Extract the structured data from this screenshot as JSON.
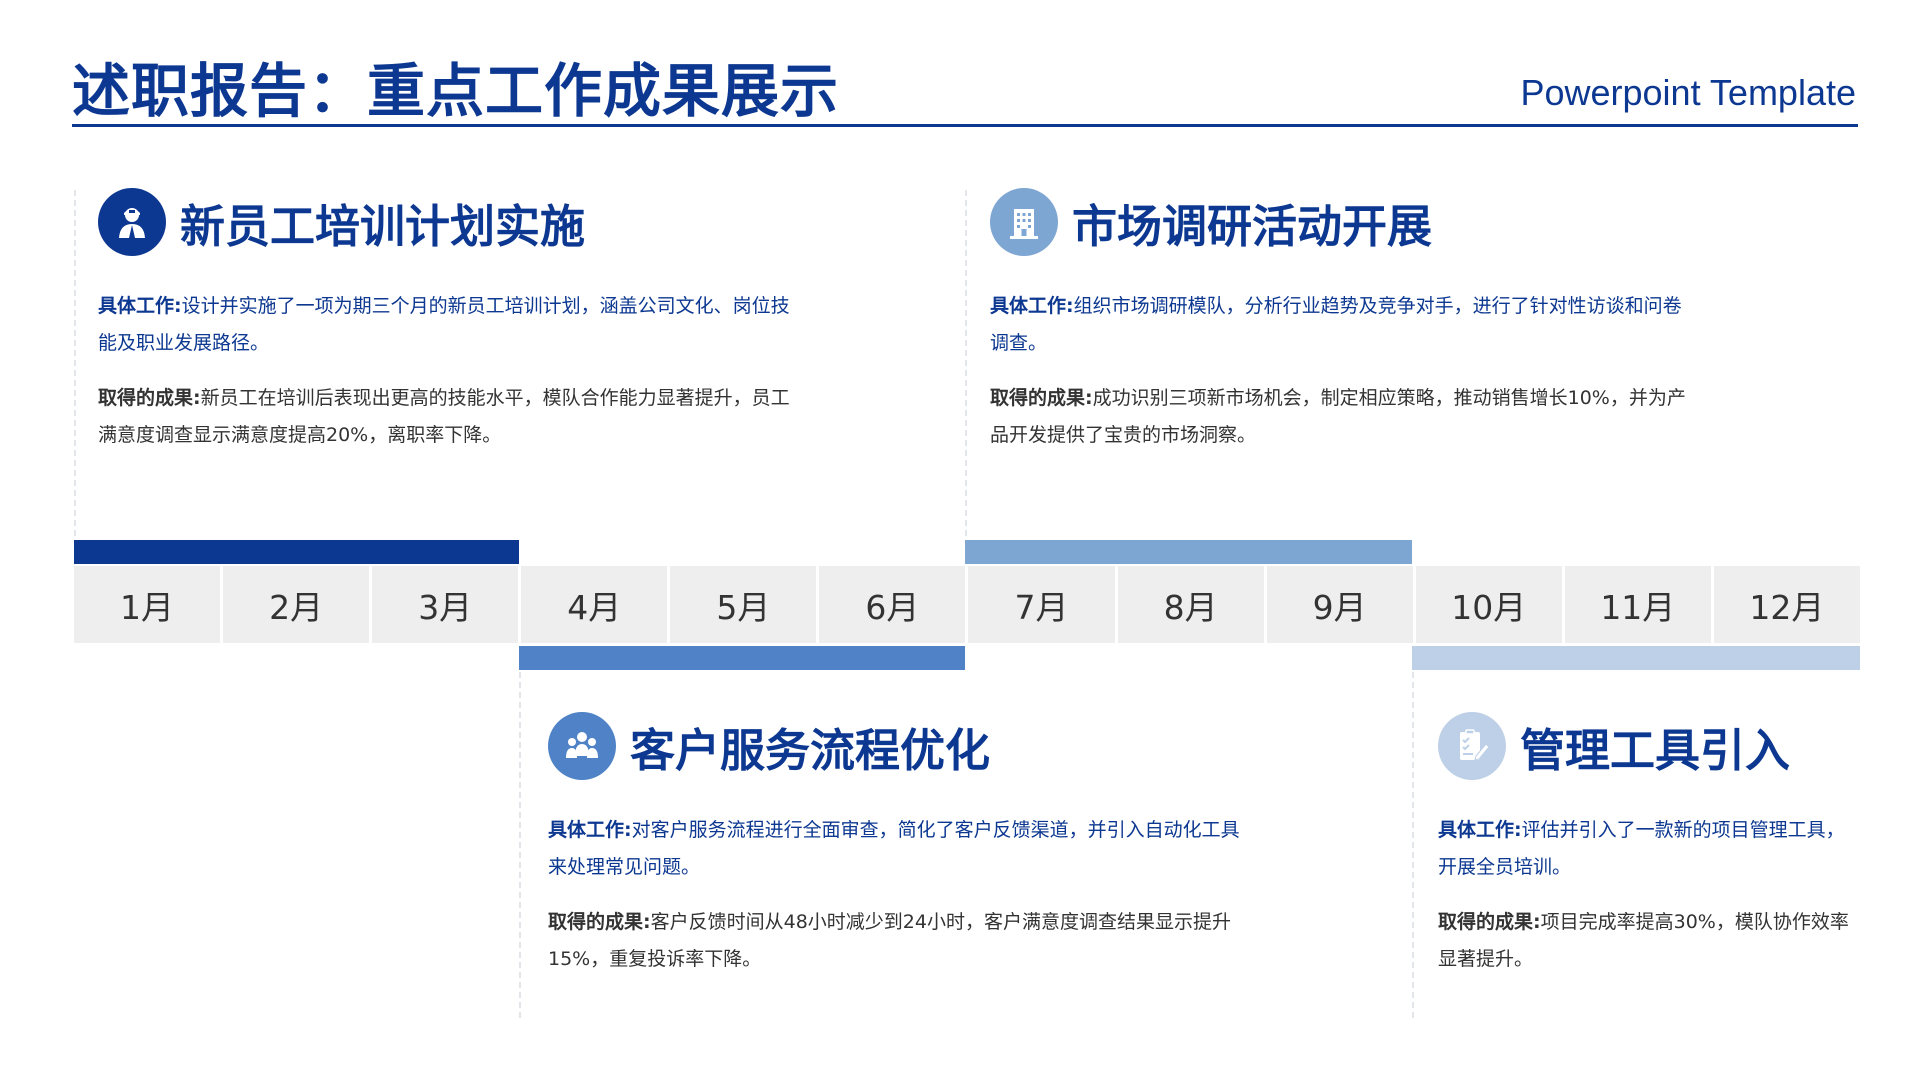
{
  "header": {
    "title": "述职报告：重点工作成果展示",
    "subtitle": "Powerpoint Template"
  },
  "colors": {
    "primary": "#0d3891",
    "bar1": "#0d3891",
    "bar2": "#4f82c6",
    "bar3": "#7ea6d3",
    "bar4": "#bdd0e8"
  },
  "timeline": {
    "months": [
      "1月",
      "2月",
      "3月",
      "4月",
      "5月",
      "6月",
      "7月",
      "8月",
      "9月",
      "10月",
      "11月",
      "12月"
    ]
  },
  "sections": [
    {
      "heading": "新员工培训计划实施",
      "icon": "employee-icon",
      "work_label": "具体工作:",
      "work_text": "设计并实施了一项为期三个月的新员工培训计划，涵盖公司文化、岗位技能及职业发展路径。",
      "result_label": "取得的成果:",
      "result_text": "新员工在培训后表现出更高的技能水平，模队合作能力显著提升，员工满意度调查显示满意度提高20%，离职率下降。"
    },
    {
      "heading": "市场调研活动开展",
      "icon": "building-icon",
      "work_label": "具体工作:",
      "work_text": "组织市场调研模队，分析行业趋势及竞争对手，进行了针对性访谈和问卷调查。",
      "result_label": "取得的成果:",
      "result_text": "成功识别三项新市场机会，制定相应策略，推动销售增长10%，并为产品开发提供了宝贵的市场洞察。"
    },
    {
      "heading": "客户服务流程优化",
      "icon": "team-icon",
      "work_label": "具体工作:",
      "work_text": "对客户服务流程进行全面审查，简化了客户反馈渠道，并引入自动化工具来处理常见问题。",
      "result_label": "取得的成果:",
      "result_text": "客户反馈时间从48小时减少到24小时，客户满意度调查结果显示提升15%，重复投诉率下降。"
    },
    {
      "heading": "管理工具引入",
      "icon": "checklist-icon",
      "work_label": "具体工作:",
      "work_text": "评估并引入了一款新的项目管理工具，开展全员培训。",
      "result_label": "取得的成果:",
      "result_text": "项目完成率提高30%，模队协作效率显著提升。"
    }
  ]
}
